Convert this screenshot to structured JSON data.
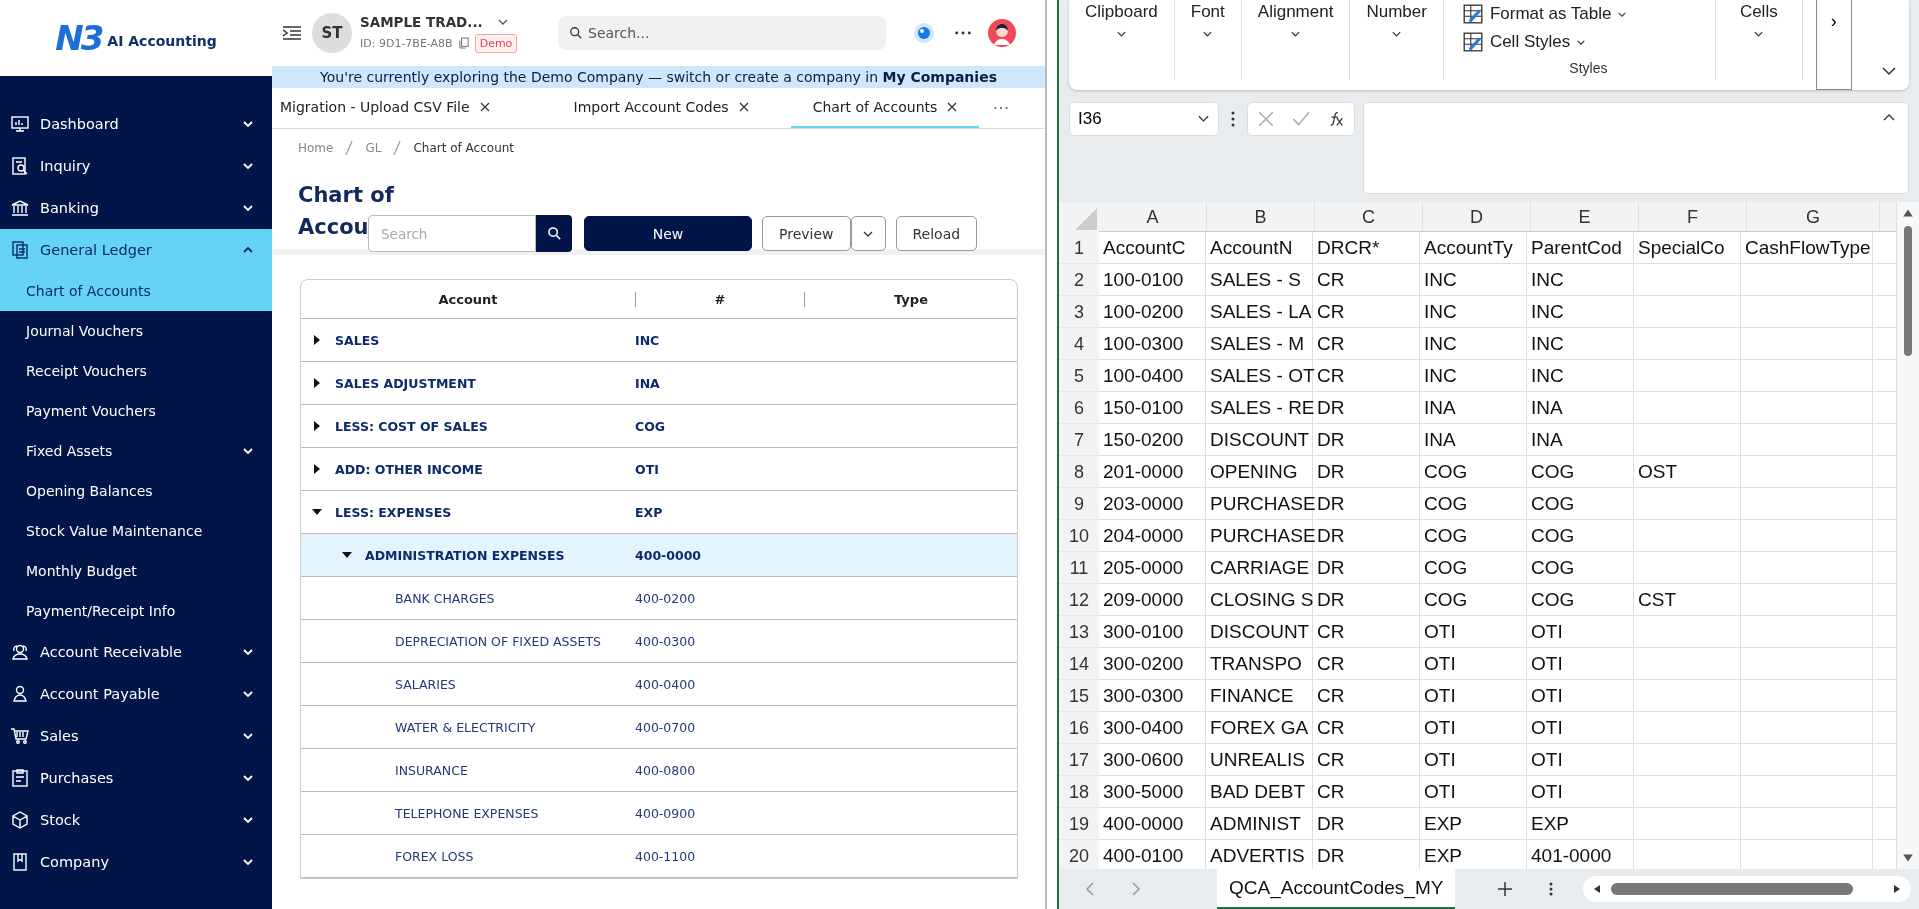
{
  "app": {
    "logo": {
      "mark": "N3",
      "name": "AI Accounting"
    },
    "company": {
      "initials": "ST",
      "name": "SAMPLE TRAD...",
      "id": "ID: 9D1-7BE-A8B",
      "badge": "Demo"
    },
    "search": {
      "placeholder": "Search..."
    },
    "banner": "You're currently exploring the Demo Company — switch or create a company in **My Companies**",
    "tabs": [
      {
        "label": "Migration - Upload CSV File",
        "selected": false
      },
      {
        "label": "Import Account Codes",
        "selected": false
      },
      {
        "label": "Chart of Accounts",
        "selected": true
      }
    ],
    "sidebar": {
      "items": [
        {
          "label": "Dashboard",
          "expanded": false,
          "selected": false
        },
        {
          "label": "Inquiry",
          "expanded": false,
          "selected": false
        },
        {
          "label": "Banking",
          "expanded": false,
          "selected": false
        },
        {
          "label": "General Ledger",
          "expanded": true,
          "selected": true,
          "children": [
            {
              "label": "Chart of Accounts",
              "selected": true,
              "expandable": false
            },
            {
              "label": "Journal Vouchers",
              "selected": false,
              "expandable": false
            },
            {
              "label": "Receipt Vouchers",
              "selected": false,
              "expandable": false
            },
            {
              "label": "Payment Vouchers",
              "selected": false,
              "expandable": false
            },
            {
              "label": "Fixed Assets",
              "selected": false,
              "expandable": true
            },
            {
              "label": "Opening Balances",
              "selected": false,
              "expandable": false
            },
            {
              "label": "Stock Value Maintenance",
              "selected": false,
              "expandable": false
            },
            {
              "label": "Monthly Budget",
              "selected": false,
              "expandable": false
            },
            {
              "label": "Payment/Receipt Info",
              "selected": false,
              "expandable": false
            }
          ]
        },
        {
          "label": "Account Receivable",
          "expanded": false,
          "selected": false
        },
        {
          "label": "Account Payable",
          "expanded": false,
          "selected": false
        },
        {
          "label": "Sales",
          "expanded": false,
          "selected": false
        },
        {
          "label": "Purchases",
          "expanded": false,
          "selected": false
        },
        {
          "label": "Stock",
          "expanded": false,
          "selected": false
        },
        {
          "label": "Company",
          "expanded": false,
          "selected": false
        }
      ]
    },
    "breadcrumb": [
      "Home",
      "GL",
      "Chart of Account"
    ],
    "page_title_lines": [
      "Chart of",
      "Accou"
    ],
    "toolbar": {
      "search_placeholder": "Search",
      "buttons": [
        "New",
        "Preview",
        "Reload"
      ]
    },
    "table": {
      "columns": [
        "Account",
        "#",
        "Type"
      ],
      "rows": [
        {
          "account": "SALES",
          "code": "INC",
          "expanded": false,
          "selected": false
        },
        {
          "account": "SALES ADJUSTMENT",
          "code": "INA",
          "expanded": false,
          "selected": false
        },
        {
          "account": "LESS: COST OF SALES",
          "code": "COG",
          "expanded": false,
          "selected": false
        },
        {
          "account": "ADD: OTHER INCOME",
          "code": "OTI",
          "expanded": false,
          "selected": false
        },
        {
          "account": "LESS: EXPENSES",
          "code": "EXP",
          "expanded": true,
          "selected": false,
          "children": [
            {
              "account": "ADMINISTRATION EXPENSES",
              "code": "400-0000",
              "expanded": true,
              "selected": true,
              "children": [
                {
                  "account": "BANK CHARGES",
                  "code": "400-0200",
                  "selected": false
                },
                {
                  "account": "DEPRECIATION OF FIXED ASSETS",
                  "code": "400-0300",
                  "selected": false
                },
                {
                  "account": "SALARIES",
                  "code": "400-0400",
                  "selected": false
                },
                {
                  "account": "WATER & ELECTRICITY",
                  "code": "400-0700",
                  "selected": false
                },
                {
                  "account": "INSURANCE",
                  "code": "400-0800",
                  "selected": false
                },
                {
                  "account": "TELEPHONE EXPENSES",
                  "code": "400-0900",
                  "selected": false
                },
                {
                  "account": "FOREX LOSS",
                  "code": "400-1100",
                  "selected": false
                }
              ]
            }
          ]
        }
      ]
    }
  },
  "excel": {
    "ribbon": {
      "groups": [
        "Clipboard",
        "Font",
        "Alignment",
        "Number"
      ],
      "styles": {
        "items": [
          "Format as Table",
          "Cell Styles"
        ],
        "label": "Styles"
      },
      "cells": "Cells",
      "scroll": "›"
    },
    "name_box": "I36",
    "columns": [
      "A",
      "B",
      "C",
      "D",
      "E",
      "F",
      "G"
    ],
    "rows": [
      {
        "number": "1",
        "cells": [
          "AccountC",
          "AccountN",
          "DRCR*",
          "AccountTy",
          "ParentCod",
          "SpecialCo",
          "CashFlowType"
        ]
      },
      {
        "number": "2",
        "cells": [
          "100-0100",
          "SALES - S",
          "CR",
          "INC",
          "INC",
          "",
          ""
        ]
      },
      {
        "number": "3",
        "cells": [
          "100-0200",
          "SALES - LA",
          "CR",
          "INC",
          "INC",
          "",
          ""
        ]
      },
      {
        "number": "4",
        "cells": [
          "100-0300",
          "SALES - M",
          "CR",
          "INC",
          "INC",
          "",
          ""
        ]
      },
      {
        "number": "5",
        "cells": [
          "100-0400",
          "SALES - OT",
          "CR",
          "INC",
          "INC",
          "",
          ""
        ]
      },
      {
        "number": "6",
        "cells": [
          "150-0100",
          "SALES - RE",
          "DR",
          "INA",
          "INA",
          "",
          ""
        ]
      },
      {
        "number": "7",
        "cells": [
          "150-0200",
          "DISCOUNT",
          "DR",
          "INA",
          "INA",
          "",
          ""
        ]
      },
      {
        "number": "8",
        "cells": [
          "201-0000",
          "OPENING",
          "DR",
          "COG",
          "COG",
          "OST",
          ""
        ]
      },
      {
        "number": "9",
        "cells": [
          "203-0000",
          "PURCHASE",
          "DR",
          "COG",
          "COG",
          "",
          ""
        ]
      },
      {
        "number": "10",
        "cells": [
          "204-0000",
          "PURCHASE",
          "DR",
          "COG",
          "COG",
          "",
          ""
        ]
      },
      {
        "number": "11",
        "cells": [
          "205-0000",
          "CARRIAGE",
          "DR",
          "COG",
          "COG",
          "",
          ""
        ]
      },
      {
        "number": "12",
        "cells": [
          "209-0000",
          "CLOSING S",
          "DR",
          "COG",
          "COG",
          "CST",
          ""
        ]
      },
      {
        "number": "13",
        "cells": [
          "300-0100",
          "DISCOUNT",
          "CR",
          "OTI",
          "OTI",
          "",
          ""
        ]
      },
      {
        "number": "14",
        "cells": [
          "300-0200",
          "TRANSPO",
          "CR",
          "OTI",
          "OTI",
          "",
          ""
        ]
      },
      {
        "number": "15",
        "cells": [
          "300-0300",
          "FINANCE",
          "CR",
          "OTI",
          "OTI",
          "",
          ""
        ]
      },
      {
        "number": "16",
        "cells": [
          "300-0400",
          "FOREX GA",
          "CR",
          "OTI",
          "OTI",
          "",
          ""
        ]
      },
      {
        "number": "17",
        "cells": [
          "300-0600",
          "UNREALIS",
          "CR",
          "OTI",
          "OTI",
          "",
          ""
        ]
      },
      {
        "number": "18",
        "cells": [
          "300-5000",
          "BAD DEBT",
          "CR",
          "OTI",
          "OTI",
          "",
          ""
        ]
      },
      {
        "number": "19",
        "cells": [
          "400-0000",
          "ADMINIST",
          "DR",
          "EXP",
          "EXP",
          "",
          ""
        ]
      },
      {
        "number": "20",
        "cells": [
          "400-0100",
          "ADVERTIS",
          "DR",
          "EXP",
          "401-0000",
          "",
          ""
        ]
      }
    ],
    "sheet_tabs": [
      {
        "label": "QCA_AccountCodes_MY",
        "selected": true
      }
    ]
  }
}
